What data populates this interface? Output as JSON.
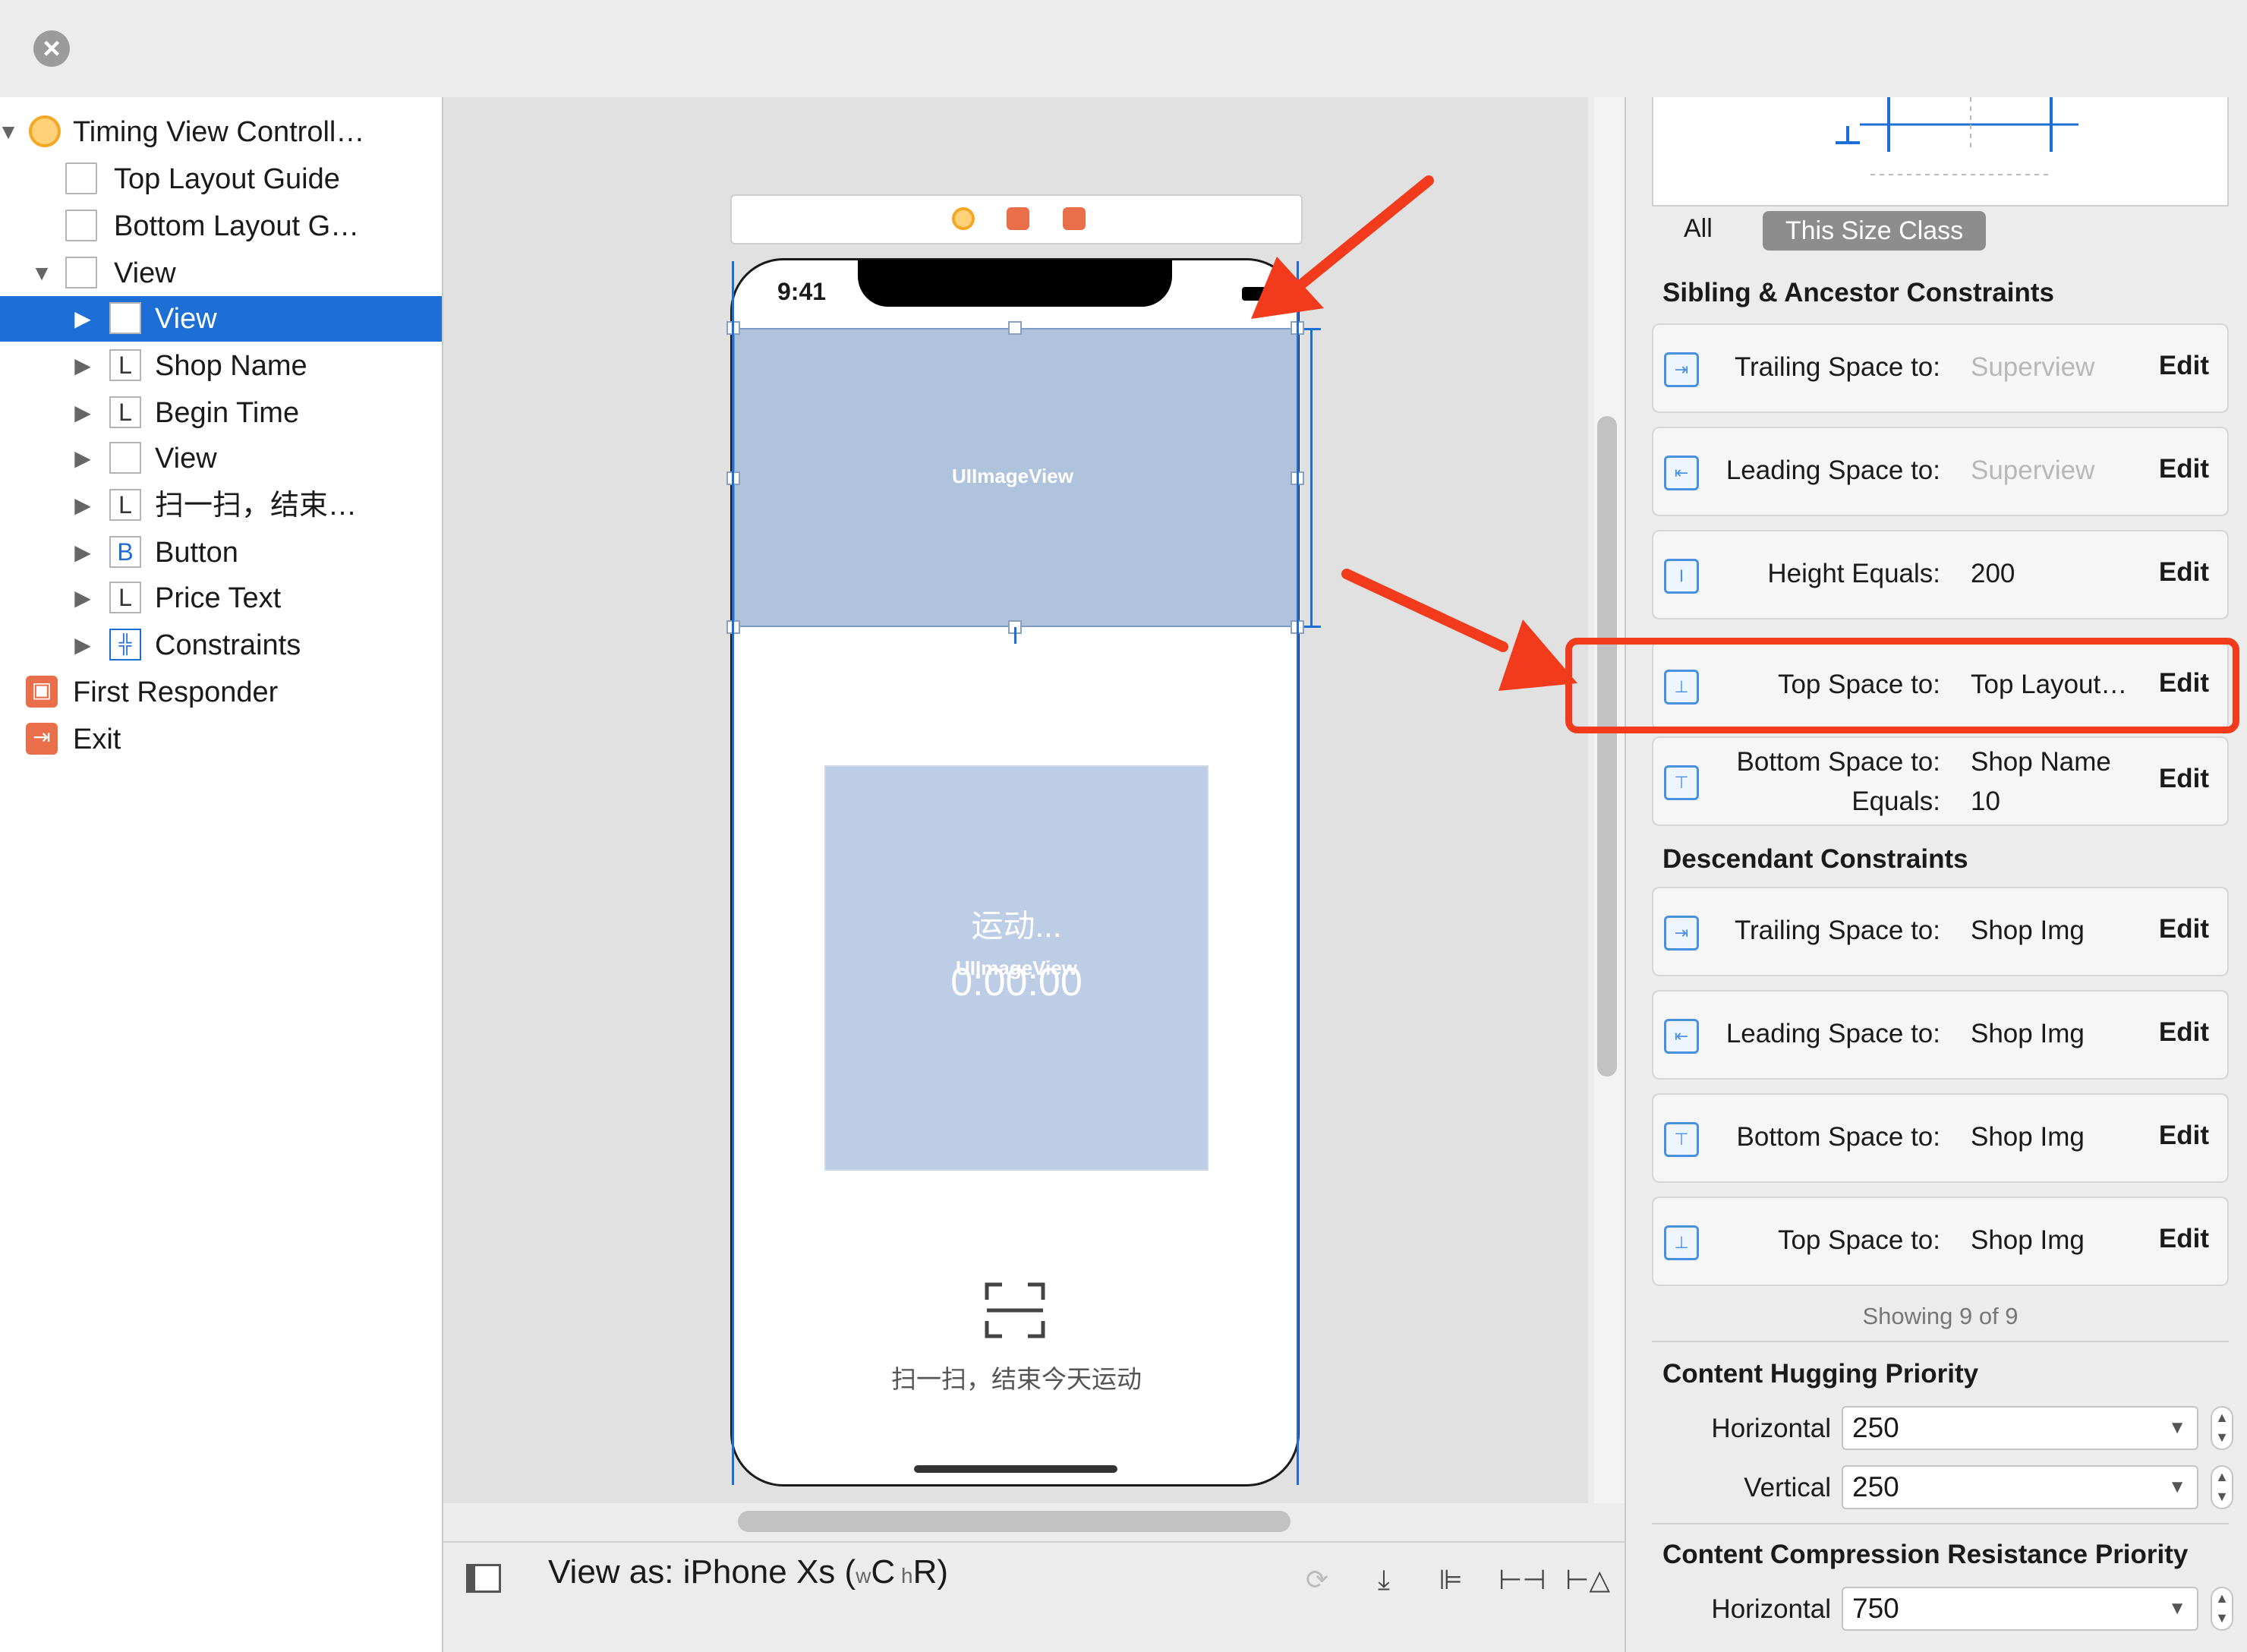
{
  "outline": {
    "items": [
      {
        "label": "Timing View Controll…",
        "icon": "view-controller-icon",
        "disclosure": "expanded"
      },
      {
        "label": "Top Layout Guide",
        "icon": "layout-guide-icon"
      },
      {
        "label": "Bottom Layout G…",
        "icon": "layout-guide-icon"
      },
      {
        "label": "View",
        "icon": "view-icon",
        "disclosure": "expanded"
      },
      {
        "label": "View",
        "icon": "view-icon",
        "disclosure": "collapsed",
        "selected": true
      },
      {
        "label": "Shop Name",
        "icon": "label-icon",
        "disclosure": "collapsed",
        "badge": "L"
      },
      {
        "label": "Begin Time",
        "icon": "label-icon",
        "disclosure": "collapsed",
        "badge": "L"
      },
      {
        "label": "View",
        "icon": "view-icon",
        "disclosure": "collapsed"
      },
      {
        "label": "扫一扫，结束…",
        "icon": "label-icon",
        "disclosure": "collapsed",
        "badge": "L"
      },
      {
        "label": "Button",
        "icon": "button-icon",
        "disclosure": "collapsed",
        "badge": "B"
      },
      {
        "label": "Price Text",
        "icon": "label-icon",
        "disclosure": "collapsed",
        "badge": "L"
      },
      {
        "label": "Constraints",
        "icon": "constraints-icon",
        "disclosure": "collapsed"
      },
      {
        "label": "First Responder",
        "icon": "first-responder-icon"
      },
      {
        "label": "Exit",
        "icon": "exit-icon"
      }
    ]
  },
  "canvas": {
    "status_time": "9:41",
    "image_view_label": "UIImageView",
    "image_view2_label": "UIImageView",
    "motion_title": "运动...",
    "timer": "0:00:00",
    "scan_text": "扫一扫，结束今天运动"
  },
  "bottom_bar": {
    "view_as_prefix": "View as: iPhone Xs (",
    "w_small": "w",
    "w_big": "C",
    "h_small": " h",
    "h_big": "R",
    "view_as_suffix": ")"
  },
  "inspector": {
    "tab_all": "All",
    "tab_size_class": "This Size Class",
    "sibling_heading": "Sibling & Ancestor Constraints",
    "descendant_heading": "Descendant Constraints",
    "edit_label": "Edit",
    "sibling_constraints": [
      {
        "key": "Trailing Space to:",
        "value": "Superview",
        "muted": true
      },
      {
        "key": "Leading Space to:",
        "value": "Superview",
        "muted": true
      },
      {
        "key": "Height Equals:",
        "value": "200"
      },
      {
        "key": "Top Space to:",
        "value": "Top Layout…",
        "highlighted": true
      },
      {
        "key": "Bottom Space to:",
        "value": "Shop Name",
        "key2": "Equals:",
        "value2": "10"
      }
    ],
    "descendant_constraints": [
      {
        "key": "Trailing Space to:",
        "value": "Shop Img"
      },
      {
        "key": "Leading Space to:",
        "value": "Shop Img"
      },
      {
        "key": "Bottom Space to:",
        "value": "Shop Img"
      },
      {
        "key": "Top Space to:",
        "value": "Shop Img"
      }
    ],
    "showing": "Showing 9 of 9",
    "hugging_heading": "Content Hugging Priority",
    "compression_heading": "Content Compression Resistance Priority",
    "horizontal_label": "Horizontal",
    "vertical_label": "Vertical",
    "hugging_horizontal": "250",
    "hugging_vertical": "250",
    "compression_horizontal": "750"
  },
  "colors": {
    "selection": "#1d6fd6",
    "highlight_red": "#f23b1c",
    "image_view_fill": "#b0c3dd"
  }
}
